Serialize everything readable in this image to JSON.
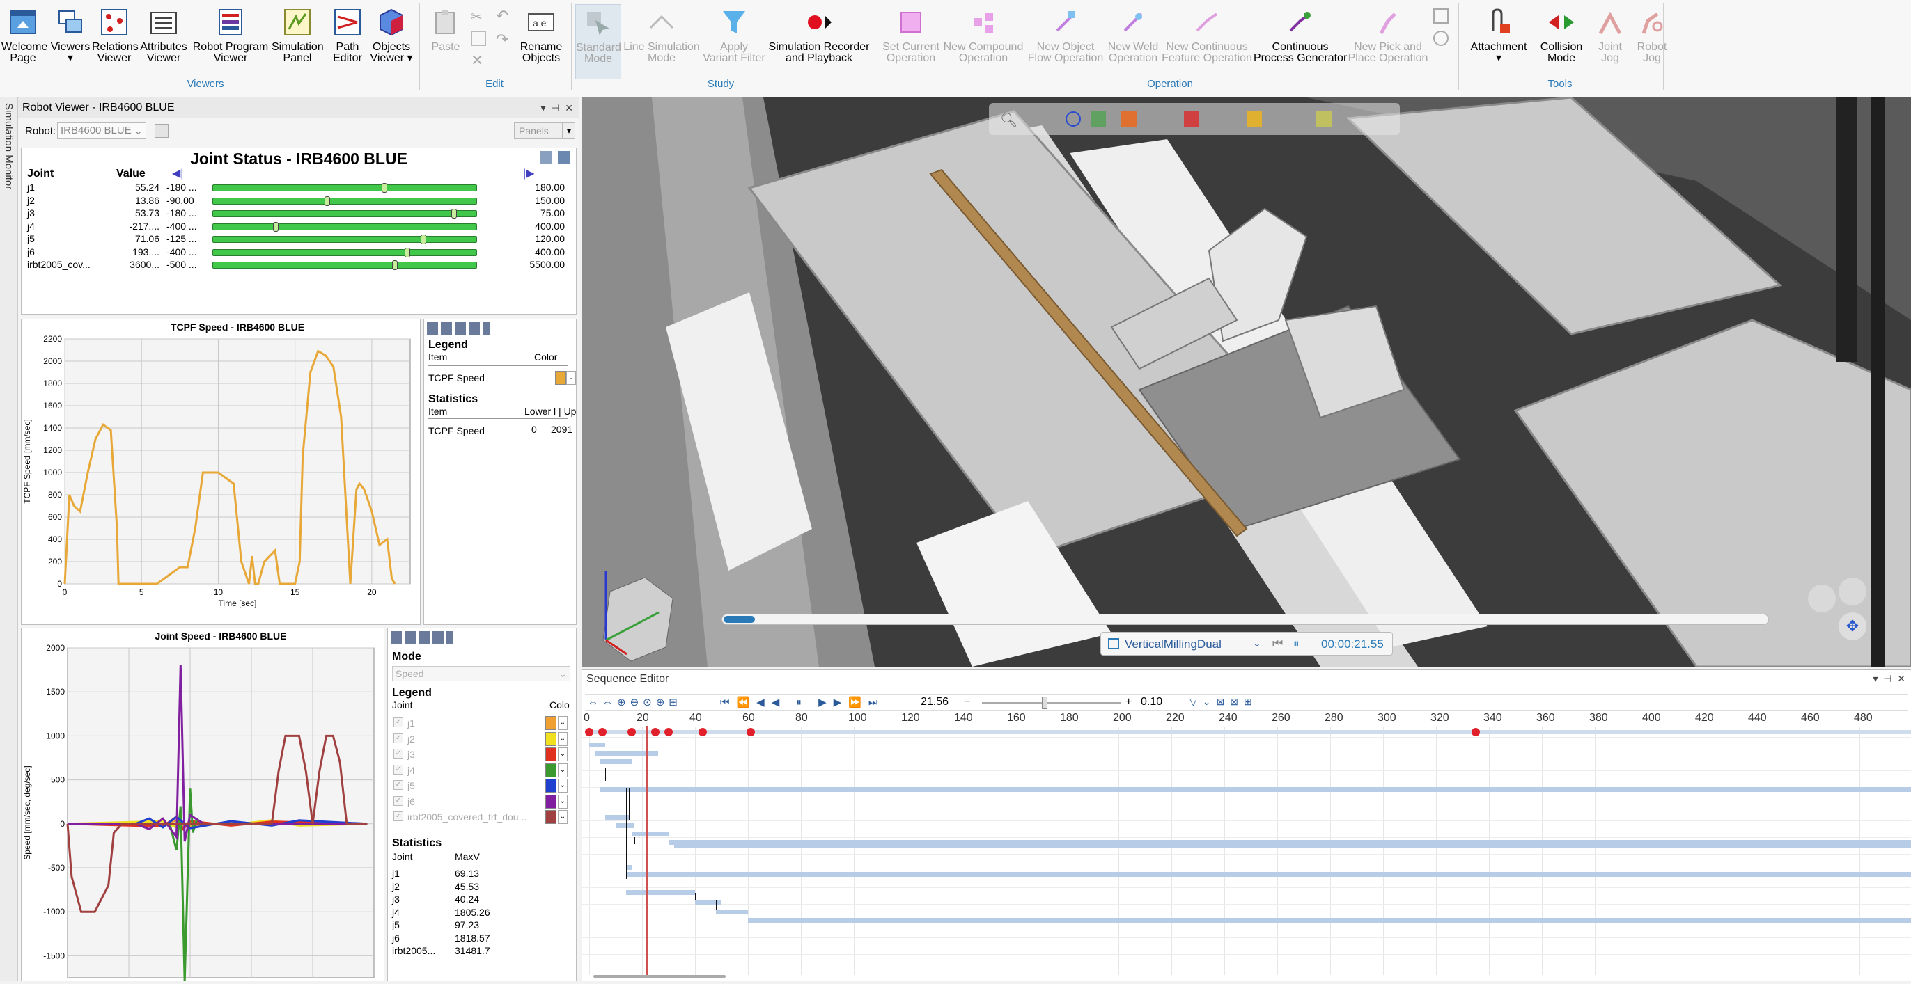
{
  "ribbon": {
    "viewers": [
      {
        "id": "welcome",
        "label": "Welcome\nPage",
        "icon": "welcome-page-icon"
      },
      {
        "id": "viewers",
        "label": "Viewers\n▾",
        "icon": "viewers-icon"
      },
      {
        "id": "relations",
        "label": "Relations\nViewer",
        "icon": "relations-viewer-icon"
      },
      {
        "id": "attributes",
        "label": "Attributes\nViewer",
        "icon": "attributes-viewer-icon"
      },
      {
        "id": "robotprogram",
        "label": "Robot Program\nViewer",
        "icon": "robot-program-viewer-icon"
      },
      {
        "id": "simpanel",
        "label": "Simulation\nPanel",
        "icon": "simulation-panel-icon"
      },
      {
        "id": "patheditor",
        "label": "Path\nEditor",
        "icon": "path-editor-icon"
      },
      {
        "id": "objviewer",
        "label": "Objects\nViewer ▾",
        "icon": "objects-viewer-icon"
      }
    ],
    "edit": {
      "paste": "Paste",
      "rename": "Rename\nObjects"
    },
    "study": {
      "standard": "Standard\nMode",
      "linesim": "Line Simulation\nMode",
      "variant": "Apply\nVariant Filter",
      "recorder": "Simulation Recorder\nand Playback"
    },
    "operation": {
      "setcurrent": "Set Current\nOperation",
      "compound": "New Compound\nOperation",
      "objflow": "New Object\nFlow Operation",
      "weld": "New Weld\nOperation",
      "contfeat": "New Continuous\nFeature Operation",
      "contgen": "Continuous\nProcess Generator",
      "pickplace": "New Pick and\nPlace Operation"
    },
    "tools": {
      "attachment": "Attachment\n▾",
      "collision": "Collision\nMode",
      "jointjog": "Joint\nJog",
      "robotjog": "Robot\nJog"
    },
    "groups": {
      "viewers": "Viewers",
      "edit": "Edit",
      "study": "Study",
      "operation": "Operation",
      "tools": "Tools"
    }
  },
  "sidebar": {
    "label": "Simulation Monitor"
  },
  "robotviewer": {
    "title": "Robot Viewer - IRB4600 BLUE",
    "robot_label": "Robot:",
    "robot_value": "IRB4600 BLUE",
    "panels_label": "Panels",
    "joint_status_title": "Joint Status - IRB4600 BLUE",
    "col_joint": "Joint",
    "col_value": "Value",
    "joints": [
      {
        "name": "j1",
        "value": "55.24",
        "low": "-180 ...",
        "high": "180.00",
        "pos": 0.65
      },
      {
        "name": "j2",
        "value": "13.86",
        "low": "-90.00",
        "high": "150.00",
        "pos": 0.43
      },
      {
        "name": "j3",
        "value": "53.73",
        "low": "-180 ...",
        "high": "75.00",
        "pos": 0.92
      },
      {
        "name": "j4",
        "value": "-217....",
        "low": "-400 ...",
        "high": "400.00",
        "pos": 0.23
      },
      {
        "name": "j5",
        "value": "71.06",
        "low": "-125 ...",
        "high": "120.00",
        "pos": 0.8
      },
      {
        "name": "j6",
        "value": "193....",
        "low": "-400 ...",
        "high": "400.00",
        "pos": 0.74
      },
      {
        "name": "irbt2005_cov...",
        "value": "3600...",
        "low": "-500 ...",
        "high": "5500.00",
        "pos": 0.69
      }
    ]
  },
  "tcpf": {
    "legend_title": "Legend",
    "item": "Item",
    "color": "Color",
    "item_name": "TCPF Speed",
    "stats_title": "Statistics",
    "stat_lower": "Lower l",
    "stat_upper": "Upper lir",
    "stat_lower_val": "0",
    "stat_upper_val": "2091"
  },
  "jointspeed": {
    "mode_title": "Mode",
    "mode_value": "Speed",
    "legend_title": "Legend",
    "joint": "Joint",
    "color": "Colo",
    "legend": [
      {
        "name": "j1",
        "color": "#f0a030"
      },
      {
        "name": "j2",
        "color": "#f0e020"
      },
      {
        "name": "j3",
        "color": "#e03020"
      },
      {
        "name": "j4",
        "color": "#3a9a30"
      },
      {
        "name": "j5",
        "color": "#2040d0"
      },
      {
        "name": "j6",
        "color": "#8020a0"
      },
      {
        "name": "irbt2005_covered_trf_dou...",
        "color": "#a04040"
      }
    ],
    "stats_title": "Statistics",
    "stats_joint": "Joint",
    "stats_max": "MaxV",
    "stats": [
      {
        "name": "j1",
        "v": "69.13"
      },
      {
        "name": "j2",
        "v": "45.53"
      },
      {
        "name": "j3",
        "v": "40.24"
      },
      {
        "name": "j4",
        "v": "1805.26"
      },
      {
        "name": "j5",
        "v": "97.23"
      },
      {
        "name": "j6",
        "v": "1818.57"
      },
      {
        "name": "irbt2005...",
        "v": "31481.7"
      }
    ]
  },
  "viewport": {
    "sim_name": "VerticalMillingDual",
    "time": "00:00:21.55",
    "progress": 0.03
  },
  "sequence": {
    "title": "Sequence Editor",
    "time_value": "21.56",
    "speed": "0.10",
    "ticks": [
      "0",
      "20",
      "40",
      "60",
      "80",
      "100",
      "120",
      "140",
      "160",
      "180",
      "200",
      "220",
      "240",
      "260",
      "280",
      "300",
      "320",
      "340",
      "360",
      "380",
      "400",
      "420",
      "440",
      "460",
      "480"
    ],
    "current": 21.56
  },
  "chart_data": [
    {
      "type": "line",
      "title": "TCPF Speed - IRB4600 BLUE",
      "xlabel": "Time [sec]",
      "ylabel": "TCPF Speed [mm/sec]",
      "xlim": [
        0,
        22.5
      ],
      "ylim": [
        0,
        2200
      ],
      "xticks": [
        "0",
        "5",
        "10",
        "15",
        "20"
      ],
      "yticks": [
        "0",
        "200",
        "400",
        "600",
        "800",
        "1000",
        "1200",
        "1400",
        "1600",
        "1800",
        "2000",
        "2200"
      ],
      "series": [
        {
          "name": "TCPF Speed",
          "color": "#e8a838",
          "x": [
            0,
            0.3,
            0.6,
            1,
            1.5,
            2,
            2.5,
            3,
            3.4,
            3.5,
            6,
            7,
            7.5,
            8,
            8.5,
            9,
            10,
            11,
            11.5,
            12,
            12.2,
            12.4,
            12.6,
            13,
            13.7,
            14,
            14.5,
            15,
            15.3,
            15.5,
            16,
            16.5,
            17,
            17.5,
            18,
            18.6,
            19,
            19.2,
            19.5,
            20,
            20.5,
            21,
            21.3,
            21.5
          ],
          "y": [
            0,
            800,
            700,
            650,
            1000,
            1300,
            1430,
            1380,
            500,
            0,
            0,
            100,
            150,
            150,
            500,
            1000,
            1000,
            900,
            200,
            0,
            250,
            0,
            0,
            200,
            300,
            0,
            0,
            0,
            200,
            1150,
            1900,
            2090,
            2050,
            1950,
            1500,
            0,
            850,
            900,
            850,
            650,
            350,
            400,
            50,
            0
          ]
        }
      ]
    },
    {
      "type": "line",
      "title": "Joint Speed - IRB4600 BLUE",
      "xlabel": "",
      "ylabel": "Speed [mm/sec, deg/sec]",
      "xlim": [
        0,
        22.5
      ],
      "ylim": [
        -1750,
        2000
      ],
      "yticks": [
        "-1500",
        "-1000",
        "-500",
        "0",
        "500",
        "1000",
        "1500",
        "2000"
      ],
      "series": [
        {
          "name": "j1",
          "color": "#f0a030",
          "x": [
            0,
            7,
            8,
            9,
            12,
            15,
            17,
            22
          ],
          "y": [
            0,
            -20,
            40,
            -30,
            20,
            -10,
            30,
            0
          ]
        },
        {
          "name": "j2",
          "color": "#f0e020",
          "x": [
            0,
            7,
            8,
            9,
            12,
            15,
            17,
            22
          ],
          "y": [
            0,
            30,
            -40,
            20,
            -10,
            40,
            -20,
            0
          ]
        },
        {
          "name": "j3",
          "color": "#e03020",
          "x": [
            0,
            7,
            8,
            8.5,
            9,
            12,
            15,
            22
          ],
          "y": [
            0,
            -30,
            80,
            -60,
            30,
            -20,
            25,
            0
          ]
        },
        {
          "name": "j4",
          "color": "#3a9a30",
          "x": [
            0,
            7.5,
            8,
            8.3,
            8.6,
            9,
            9.2,
            9.5,
            10,
            22
          ],
          "y": [
            0,
            0,
            -300,
            200,
            -1800,
            400,
            -100,
            50,
            0,
            0
          ]
        },
        {
          "name": "j5",
          "color": "#2040d0",
          "x": [
            0,
            5,
            6,
            7,
            8,
            9,
            12,
            15,
            17,
            22
          ],
          "y": [
            0,
            0,
            60,
            -40,
            80,
            -50,
            30,
            -20,
            40,
            0
          ]
        },
        {
          "name": "j6",
          "color": "#8020a0",
          "x": [
            0,
            5,
            6,
            7,
            8,
            8.3,
            8.6,
            9,
            10,
            22
          ],
          "y": [
            0,
            0,
            -60,
            60,
            -150,
            1810,
            -200,
            100,
            0,
            0
          ]
        },
        {
          "name": "irbt2005_covered_trf_dou...",
          "color": "#a04040",
          "x": [
            0,
            0.3,
            1,
            2,
            3,
            3.4,
            4,
            14,
            15,
            15.5,
            16,
            17,
            17.5,
            18,
            18.5,
            19,
            19.5,
            20,
            20.5,
            21,
            22
          ],
          "y": [
            0,
            -600,
            -1000,
            -1000,
            -700,
            -100,
            0,
            0,
            0,
            600,
            1000,
            1000,
            600,
            0,
            600,
            1000,
            1000,
            700,
            0,
            0,
            0
          ]
        }
      ]
    }
  ]
}
